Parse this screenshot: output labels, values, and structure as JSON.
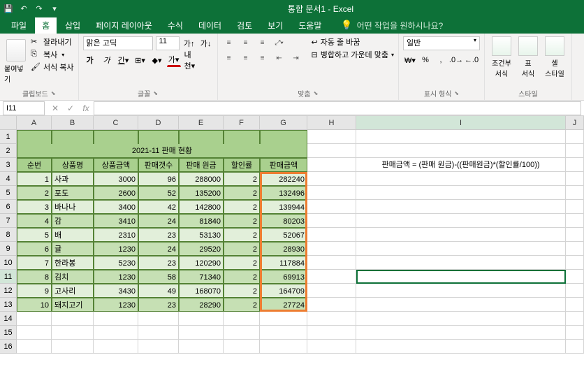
{
  "titlebar": {
    "title": "통합 문서1 - Excel"
  },
  "menubar": {
    "tabs": [
      "파일",
      "홈",
      "삽입",
      "페이지 레이아웃",
      "수식",
      "데이터",
      "검토",
      "보기",
      "도움말"
    ],
    "active_index": 1,
    "tellme": "어떤 작업을 원하시나요?"
  },
  "ribbon": {
    "clipboard": {
      "paste": "붙여넣기",
      "cut": "잘라내기",
      "copy": "복사",
      "format_painter": "서식 복사",
      "label": "클립보드"
    },
    "font": {
      "name": "맑은 고딕",
      "size": "11",
      "label": "글꼴"
    },
    "alignment": {
      "wrap": "자동 줄 바꿈",
      "merge": "병합하고 가운데 맞춤",
      "label": "맞춤"
    },
    "number": {
      "format": "일반",
      "label": "표시 형식"
    },
    "styles": {
      "cond": "조건부\n서식",
      "table": "표\n서식",
      "cell": "셀\n스타일",
      "label": "스타일"
    }
  },
  "namebox": "I11",
  "chart_data": {
    "type": "table",
    "title": "2021-11 판매 현황",
    "headers": [
      "순번",
      "상품명",
      "상품금액",
      "판매갯수",
      "판매 원금",
      "할인률",
      "판매금액"
    ],
    "rows": [
      [
        1,
        "사과",
        3000,
        96,
        288000,
        2,
        282240
      ],
      [
        2,
        "포도",
        2600,
        52,
        135200,
        2,
        132496
      ],
      [
        3,
        "바나나",
        3400,
        42,
        142800,
        2,
        139944
      ],
      [
        4,
        "감",
        3410,
        24,
        81840,
        2,
        80203
      ],
      [
        5,
        "배",
        2310,
        23,
        53130,
        2,
        52067
      ],
      [
        6,
        "귤",
        1230,
        24,
        29520,
        2,
        28930
      ],
      [
        7,
        "한라봉",
        5230,
        23,
        120290,
        2,
        117884
      ],
      [
        8,
        "김치",
        1230,
        58,
        71340,
        2,
        69913
      ],
      [
        9,
        "고사리",
        3430,
        49,
        168070,
        2,
        164709
      ],
      [
        10,
        "돼지고기",
        1230,
        23,
        28290,
        2,
        27724
      ]
    ],
    "formula_note": "판매금액 = (판매 원금)-((판매원금)*(할인률/100))"
  },
  "columns": [
    "A",
    "B",
    "C",
    "D",
    "E",
    "F",
    "G",
    "H",
    "I",
    "J"
  ]
}
